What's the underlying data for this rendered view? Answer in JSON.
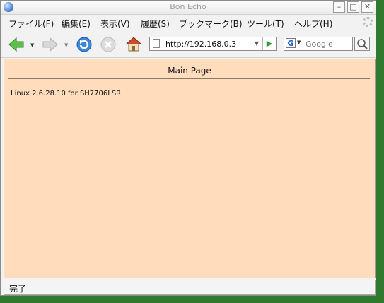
{
  "window": {
    "title": "Bon Echo"
  },
  "menu": {
    "items": [
      {
        "label": "ファイル(F)"
      },
      {
        "label": "編集(E)"
      },
      {
        "label": "表示(V)"
      },
      {
        "label": "履歴(S)"
      },
      {
        "label": "ブックマーク(B)"
      },
      {
        "label": "ツール(T)"
      },
      {
        "label": "ヘルプ(H)"
      }
    ]
  },
  "toolbar": {
    "url": "http://192.168.0.3",
    "search_placeholder": "Google",
    "icons": [
      "back-arrow-icon",
      "forward-arrow-icon",
      "reload-icon",
      "stop-icon",
      "home-icon",
      "go-arrow-icon",
      "google-logo-icon",
      "magnifier-icon"
    ]
  },
  "page": {
    "heading": "Main Page",
    "line": "Linux  2.6.28.10 for SH7706LSR",
    "background": "#ffdcbc"
  },
  "status": {
    "text": "完了"
  }
}
